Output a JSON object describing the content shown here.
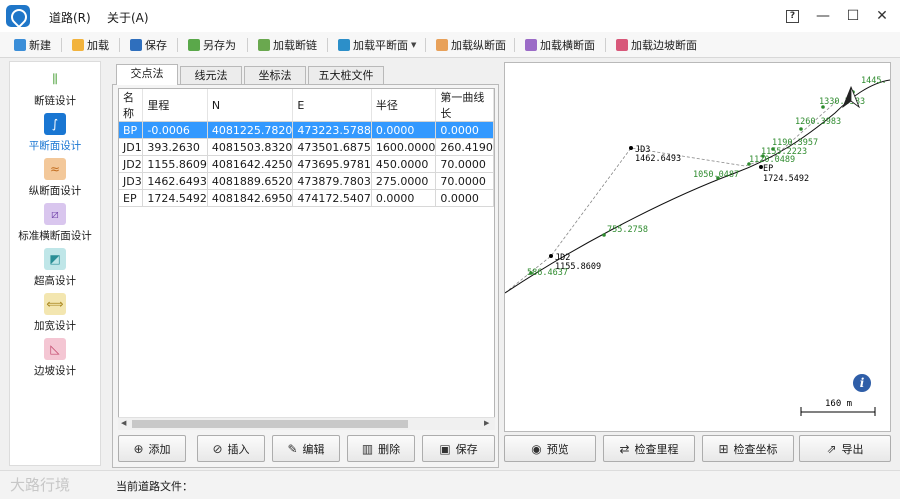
{
  "menu": {
    "road": "道路(R)",
    "about": "关于(A)"
  },
  "window": {
    "help": "?",
    "minimize": "—",
    "maximize": "☐",
    "close": "✕"
  },
  "toolbar": {
    "new": "新建",
    "load": "加载",
    "save": "保存",
    "save_as": "另存为",
    "load_chain_break": "加载断链",
    "load_horizontal": "加载平断面",
    "load_vertical": "加载纵断面",
    "load_cross": "加载横断面",
    "load_slope": "加载边坡断面"
  },
  "sidebar": {
    "items": [
      {
        "label": "断链设计",
        "icon": "chain-break-icon"
      },
      {
        "label": "平断面设计",
        "icon": "horizontal-alignment-icon"
      },
      {
        "label": "纵断面设计",
        "icon": "vertical-profile-icon"
      },
      {
        "label": "标准横断面设计",
        "icon": "cross-section-icon"
      },
      {
        "label": "超高设计",
        "icon": "superelevation-icon"
      },
      {
        "label": "加宽设计",
        "icon": "widening-icon"
      },
      {
        "label": "边坡设计",
        "icon": "slope-icon"
      }
    ]
  },
  "tabs": [
    "交点法",
    "线元法",
    "坐标法",
    "五大桩文件"
  ],
  "table": {
    "headers": [
      "名称",
      "里程",
      "N",
      "E",
      "半径",
      "第一曲线长"
    ],
    "rows": [
      [
        "BP",
        "-0.0006",
        "4081225.7820",
        "473223.5788",
        "0.0000",
        "0.0000"
      ],
      [
        "JD1",
        "393.2630",
        "4081503.8320",
        "473501.6875",
        "1600.0000",
        "260.4190"
      ],
      [
        "JD2",
        "1155.8609",
        "4081642.4250",
        "473695.9781",
        "450.0000",
        "70.0000"
      ],
      [
        "JD3",
        "1462.6493",
        "4081889.6520",
        "473879.7803",
        "275.0000",
        "70.0000"
      ],
      [
        "EP",
        "1724.5492",
        "4081842.6950",
        "474172.5407",
        "0.0000",
        "0.0000"
      ]
    ]
  },
  "buttons": {
    "add": "添加",
    "insert": "插入",
    "edit": "编辑",
    "delete": "删除",
    "save": "保存",
    "preview": "预览",
    "check_mileage": "检查里程",
    "check_coords": "检查坐标",
    "export": "导出"
  },
  "drawing": {
    "labels": {
      "jd2": "JD2",
      "jd2_mileage": "1155.8609",
      "jd3": "JD3",
      "jd3_mileage": "1462.6493",
      "ep": "EP",
      "ep_mileage": "1724.5492",
      "s586": "586.4637",
      "s755": "755.2758",
      "s1050": "1050.0487",
      "s1120": "1120.0489",
      "s1155": "1155.2223",
      "s1190": "1190.3957",
      "s1260": "1260.3983",
      "s1330": "1330.3583",
      "s1445": "1445."
    },
    "scale": "160 m",
    "line_color": "#000000",
    "station_color": "#2e8b2e"
  },
  "status": {
    "current_file": "当前道路文件："
  },
  "watermark": "大路行境"
}
